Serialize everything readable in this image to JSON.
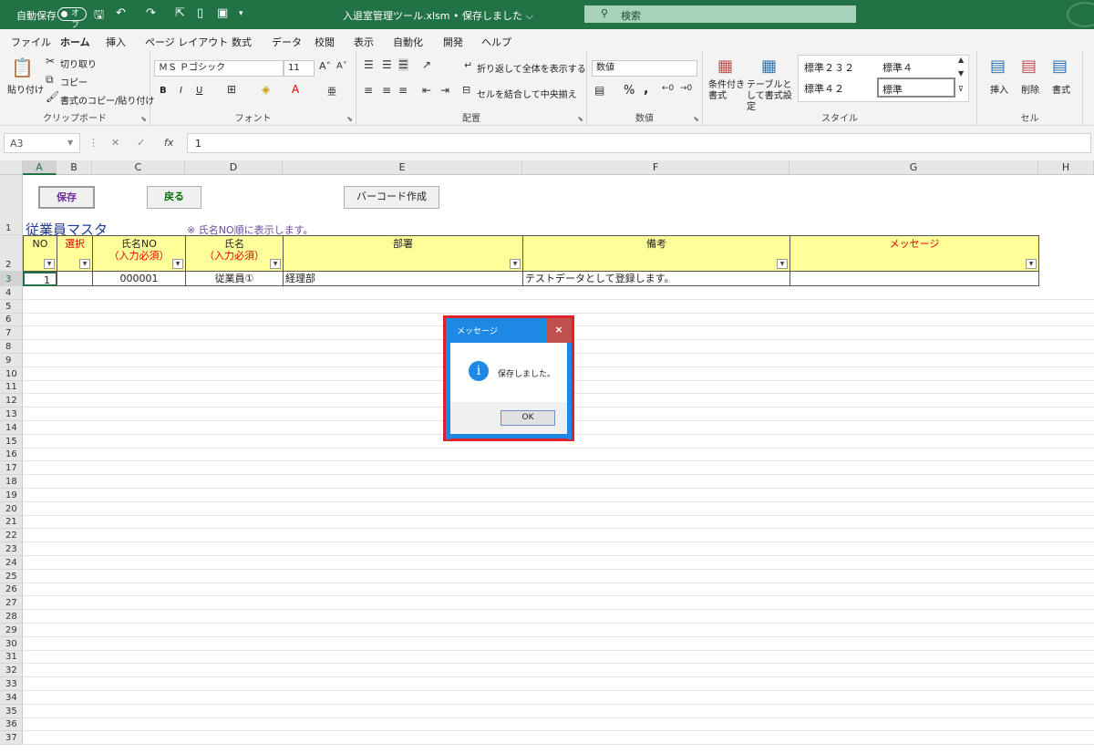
{
  "titlebar": {
    "autosave": "自動保存",
    "autosave_state": "オフ",
    "doc_title": "入退室管理ツール.xlsm • 保存しました ⌵",
    "search_placeholder": "検索"
  },
  "menu": [
    "ファイル",
    "ホーム",
    "挿入",
    "ページ レイアウト",
    "数式",
    "データ",
    "校閲",
    "表示",
    "自動化",
    "開発",
    "ヘルプ"
  ],
  "ribbon": {
    "clipboard": {
      "label": "クリップボード",
      "paste": "貼り付け",
      "cut": "切り取り",
      "copy": "コピー",
      "format_painter": "書式のコピー/貼り付け"
    },
    "font": {
      "label": "フォント",
      "font_name": "ＭＳ Ｐゴシック",
      "font_size": "11",
      "bold": "B",
      "italic": "I",
      "underline": "U"
    },
    "alignment": {
      "label": "配置",
      "wrap": "折り返して全体を表示する",
      "merge": "セルを結合して中央揃え"
    },
    "number": {
      "label": "数値",
      "format": "数値",
      "percent": "%",
      "comma": ","
    },
    "styles": {
      "label": "スタイル",
      "conditional": "条件付き書式",
      "table": "テーブルとして書式設定",
      "style1": "標準２３２",
      "style2": "標準４",
      "style3": "標準４２",
      "style4": "標準"
    },
    "cells": {
      "label": "セル",
      "insert": "挿入",
      "delete": "削除",
      "format": "書式"
    }
  },
  "formula": {
    "namebox": "A3",
    "value": "1",
    "fx": "fx"
  },
  "columns": [
    "A",
    "B",
    "C",
    "D",
    "E",
    "F",
    "G",
    "H"
  ],
  "rows": [
    "1",
    "2",
    "3",
    "4",
    "5",
    "6",
    "7",
    "8",
    "9",
    "10",
    "11",
    "12",
    "13",
    "14",
    "15",
    "16",
    "17",
    "18",
    "19",
    "20",
    "21",
    "22",
    "23",
    "24",
    "25",
    "26",
    "27",
    "28",
    "29",
    "30",
    "31",
    "32",
    "33",
    "34",
    "35",
    "36",
    "37"
  ],
  "sheet": {
    "save_button": "保存",
    "back_button": "戻る",
    "barcode_button": "バーコード作成",
    "title": "従業員マスタ",
    "note": "※ 氏名NO順に表示します。",
    "headers": {
      "no": "NO",
      "select": "選択",
      "emp_no": "氏名NO",
      "emp_no_req": "（入力必須）",
      "name": "氏名",
      "name_req": "（入力必須）",
      "dept": "部署",
      "remarks": "備考",
      "message": "メッセージ"
    },
    "row": {
      "no": "1",
      "select": "",
      "emp_no": "000001",
      "name": "従業員①",
      "dept": "経理部",
      "remarks": "テストデータとして登録します。",
      "message": ""
    }
  },
  "dialog": {
    "title": "メッセージ",
    "close": "×",
    "icon": "i",
    "message": "保存しました。",
    "ok": "OK"
  },
  "colors": {
    "accent": "#217346",
    "header_fill": "#ffff99",
    "dialog_blue": "#1e88e5",
    "highlight_red": "#e0202a"
  }
}
